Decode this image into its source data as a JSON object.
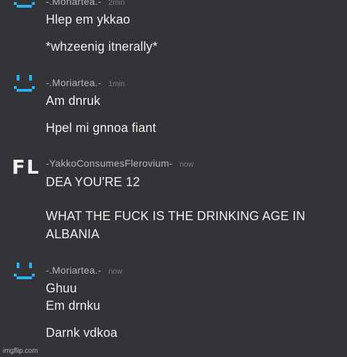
{
  "messages": [
    {
      "username": "-.Moriartea.-",
      "timestamp": "2min",
      "lines": [
        "Hlep em ykkao",
        "*whzeenig itnerally*"
      ]
    },
    {
      "username": "-.Moriartea.-",
      "timestamp": "1min",
      "lines": [
        "Am dnruk",
        "Hpel mi gnnoa fiant"
      ]
    },
    {
      "username": "-YakkoConsumesFlerovium-",
      "timestamp": "now",
      "avatar_text": "FL",
      "lines": [
        "DEA YOU'RE 12",
        "WHAT THE FUCK IS THE DRINKING AGE IN",
        "ALBANIA"
      ]
    },
    {
      "username": "-.Moriartea.-",
      "timestamp": "now",
      "lines": [
        "Ghuu",
        "Em drnku",
        "Darnk vdkoa"
      ]
    }
  ],
  "watermark": "imgflip.com",
  "colors": {
    "background": "#333437",
    "avatar_accent": "#2ab2ee",
    "username": "#b8b8b8",
    "timestamp": "#7d7d7d",
    "message_text": "#f0f0f0"
  },
  "icons": {
    "moriartea_avatar": "pixel-smiley-icon",
    "yakko_avatar": "fl-text-avatar"
  }
}
